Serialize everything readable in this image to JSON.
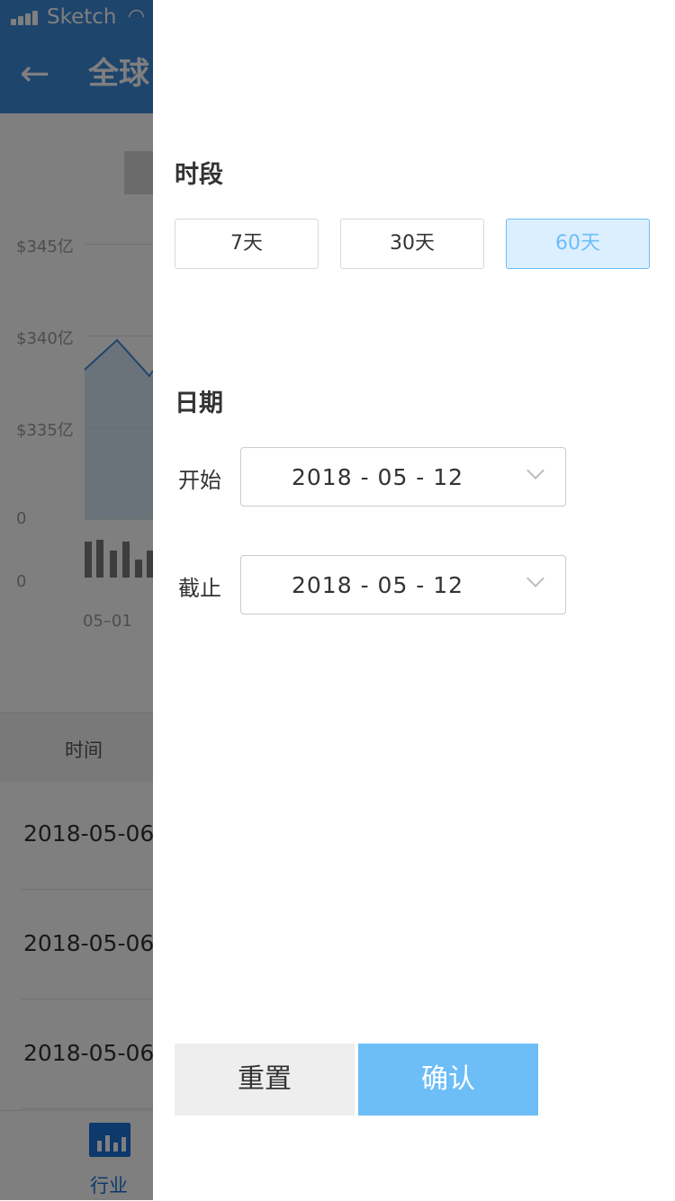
{
  "status_bar": {
    "carrier": "Sketch",
    "wifi_icon": "wifi-icon",
    "signal_icon": "signal-icon"
  },
  "nav": {
    "back_icon": "←",
    "title": "全球"
  },
  "background_chart": {
    "y_ticks": [
      "$345亿",
      "$340亿",
      "$335亿",
      "0",
      "0"
    ],
    "x_tick": "05–01"
  },
  "chart_data": {
    "type": "area",
    "x": [
      "05-01"
    ],
    "series": [
      {
        "values": [
          339.5,
          338
        ]
      }
    ],
    "yticks": [
      "$345亿",
      "$340亿",
      "$335亿"
    ]
  },
  "table": {
    "header": "时间",
    "rows": [
      "2018-05-06",
      "2018-05-06",
      "2018-05-06"
    ]
  },
  "tab_bar": {
    "active_label": "行业",
    "active_color": "#1a73d8"
  },
  "drawer": {
    "period_title": "时段",
    "periods": [
      "7天",
      "30天",
      "60天"
    ],
    "active_period": "60天",
    "date_title": "日期",
    "start_label": "开始",
    "start_value": "2018 - 05 - 12",
    "end_label": "截止",
    "end_value": "2018 - 05 - 12",
    "reset_label": "重置",
    "confirm_label": "确认",
    "accent_color": "#6dbdf7"
  }
}
